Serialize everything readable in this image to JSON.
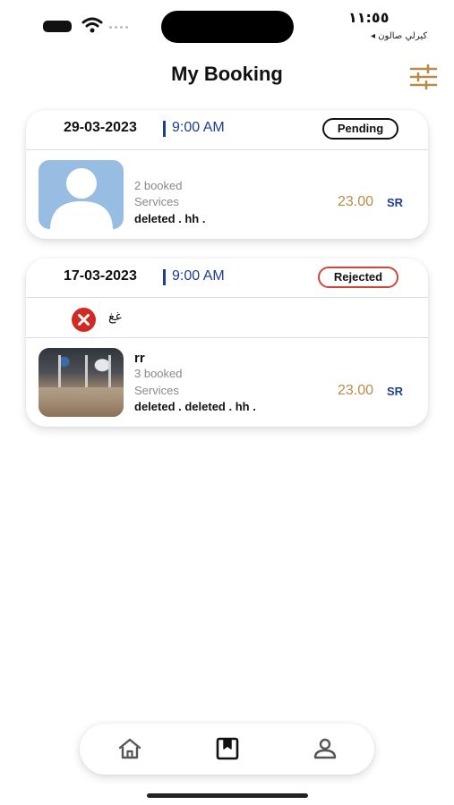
{
  "status_bar": {
    "time": "١١:٥٥",
    "back_app": "◂ كيرلي صالون"
  },
  "header": {
    "title": "My Booking",
    "filter_icon": "sliders-icon"
  },
  "colors": {
    "accent_gold": "#b98a48",
    "accent_blue": "#1d3f8f",
    "rejected_red": "#d0463c"
  },
  "bookings": [
    {
      "date": "29-03-2023",
      "time": "9:00 AM",
      "status": "Pending",
      "service_name": "",
      "booked": "2 booked",
      "services_label": "Services",
      "services_list": "deleted . hh .",
      "price": "23.00",
      "currency": "SR",
      "image": "avatar-placeholder"
    },
    {
      "date": "17-03-2023",
      "time": "9:00 AM",
      "status": "Rejected",
      "reject_reason": "غغ",
      "service_name": "rr",
      "booked": "3 booked",
      "services_label": "Services",
      "services_list": "deleted . deleted . hh .",
      "price": "23.00",
      "currency": "SR",
      "image": "salon-photo"
    }
  ],
  "tab_bar": {
    "items": [
      {
        "icon": "home-icon",
        "active": false
      },
      {
        "icon": "bookmark-icon",
        "active": true
      },
      {
        "icon": "profile-icon",
        "active": false
      }
    ]
  }
}
